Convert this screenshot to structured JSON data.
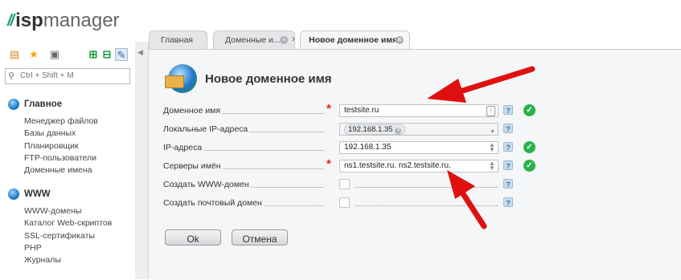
{
  "app": {
    "logo_isp": "isp",
    "logo_manager": "manager"
  },
  "sidebar": {
    "search_placeholder": "Ctrl + Shift + M",
    "sections": [
      {
        "title": "Главное",
        "items": [
          "Менеджер файлов",
          "Базы данных",
          "Планировщик",
          "FTP-пользователи",
          "Доменные имена"
        ]
      },
      {
        "title": "WWW",
        "items": [
          "WWW-домены",
          "Каталог Web-скриптов",
          "SSL-сертификаты",
          "PHP",
          "Журналы"
        ]
      }
    ]
  },
  "tabs": [
    {
      "label": "Главная"
    },
    {
      "label": "Доменные и..."
    },
    {
      "label": "Новое доменное имя"
    }
  ],
  "form": {
    "title": "Новое доменное имя",
    "fields": [
      {
        "label": "Доменное имя",
        "value": "testsite.ru",
        "required": true,
        "valid": true
      },
      {
        "label": "Локальные IP-адреса",
        "value": "192.168.1.35",
        "required": false,
        "valid": false
      },
      {
        "label": "IP-адреса",
        "value": "192.168.1.35",
        "required": false,
        "valid": true
      },
      {
        "label": "Серверы имён",
        "value": "ns1.testsite.ru. ns2.testsite.ru.",
        "required": true,
        "valid": true
      },
      {
        "label": "Создать WWW-домен",
        "value": "",
        "checked": false
      },
      {
        "label": "Создать почтовый домен",
        "value": "",
        "checked": false
      }
    ],
    "ok_label": "Ok",
    "cancel_label": "Отмена"
  },
  "colors": {
    "accent_green": "#1a9e6a",
    "valid": "#2bb24c",
    "annotation_red": "#e01010"
  }
}
